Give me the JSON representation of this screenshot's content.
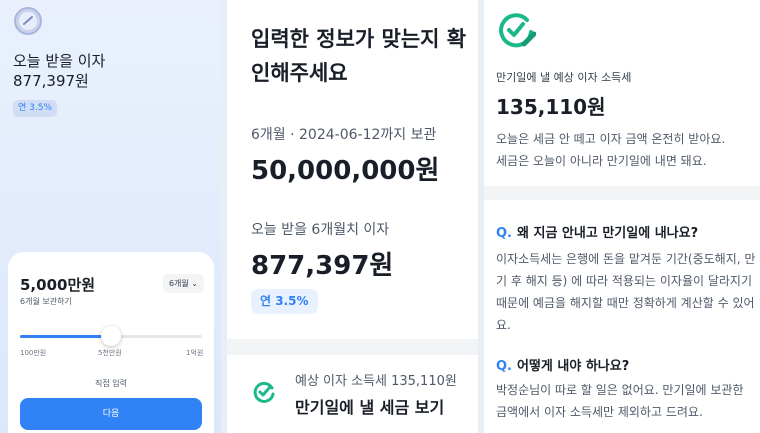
{
  "panel1": {
    "label": "오늘 받을 이자",
    "amount": "877,397원",
    "rate_badge": "연 3.5%",
    "sheet": {
      "principal": "5,000만원",
      "subtitle": "6개월 보관하기",
      "period_select": "6개월",
      "slider_value_percent": 50,
      "ticks": [
        "100만원",
        "5천만원",
        "1억원"
      ],
      "direct_input": "직접 입력",
      "next_button": "다음"
    }
  },
  "panel2": {
    "headline": "입력한 정보가 맞는지 확인해주세요",
    "meta": "6개월 · 2024-06-12까지 보관",
    "principal": "50,000,000원",
    "interest_label": "오늘 받을 6개월치 이자",
    "interest_amount": "877,397원",
    "rate_badge": "연 3.5%",
    "tax_small": "예상 이자 소득세 135,110원",
    "tax_big": "만기일에 낼 세금 보기"
  },
  "panel3": {
    "tax_label": "만기일에 낼 예상 이자 소득세",
    "tax_amount": "135,110원",
    "desc_line1": "오늘은 세금 안 떼고 이자 금액 온전히 받아요.",
    "desc_line2": "세금은 오늘이 아니라 만기일에 내면 돼요.",
    "faq": [
      {
        "q_mark": "Q.",
        "question": "왜 지금 안내고 만기일에 내나요?",
        "answer": "이자소득세는 은행에 돈을 맡겨둔 기간(중도해지, 만기 후 해지 등) 에 따라 적용되는 이자율이 달라지기 때문에 예금을 해지할 때만 정확하게 계산할 수 있어요."
      },
      {
        "q_mark": "Q.",
        "question": "어떻게 내야 하나요?",
        "answer": "박정순님이 따로 할 일은 없어요. 만기일에 보관한 금액에서 이자 소득세만 제외하고 드려요."
      }
    ]
  },
  "colors": {
    "accent": "#3182f6",
    "icon_green": "#1bb88a",
    "text": "#191f28",
    "muted": "#4e5968"
  },
  "icons": [
    "coin-icon",
    "chevron-down-icon",
    "refresh-check-icon",
    "check-pencil-icon"
  ]
}
